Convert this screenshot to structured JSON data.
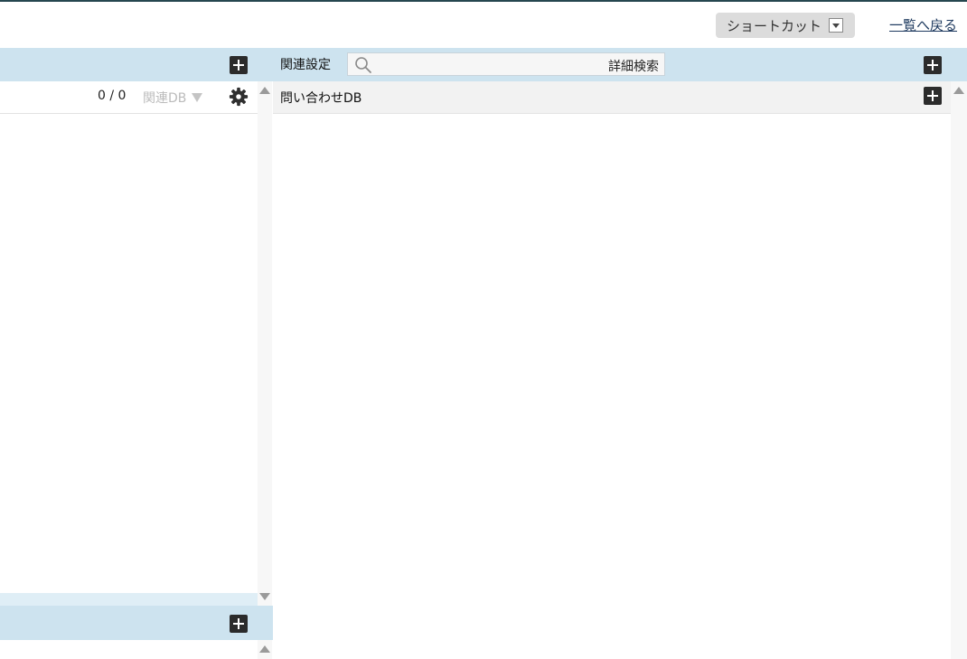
{
  "header": {
    "shortcut_label": "ショートカット",
    "back_label": "一覧へ戻る"
  },
  "related": {
    "label": "関連設定",
    "search_placeholder": "",
    "advanced_search_label": "詳細検索",
    "panel_title": "問い合わせDB"
  },
  "left_panel": {
    "counter": "0 / 0",
    "related_db_label": "関連DB"
  },
  "icons": {
    "add": "plus-icon",
    "search": "search-icon",
    "settings": "gear-icon",
    "dropdown": "chevron-down-icon"
  },
  "colors": {
    "top_border": "#26474f",
    "bar": "#cde3ef",
    "button_bg": "#dcdcdc",
    "link": "#1e3a5f"
  }
}
